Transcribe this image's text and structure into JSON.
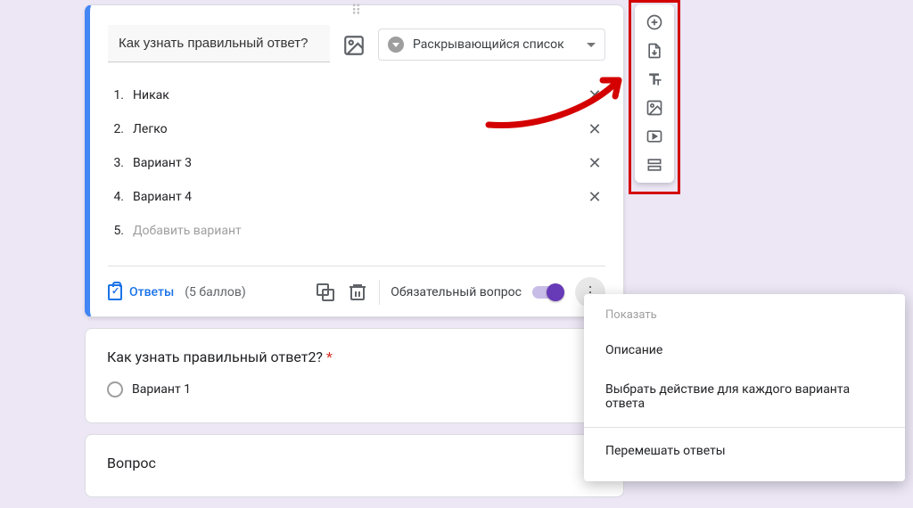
{
  "question1": {
    "title": "Как узнать правильный ответ?",
    "type_label": "Раскрывающийся список",
    "options": [
      {
        "n": "1.",
        "label": "Никак",
        "removable": true
      },
      {
        "n": "2.",
        "label": "Легко",
        "removable": true
      },
      {
        "n": "3.",
        "label": "Вариант 3",
        "removable": true
      },
      {
        "n": "4.",
        "label": "Вариант 4",
        "removable": true
      },
      {
        "n": "5.",
        "label": "Добавить вариант",
        "removable": false,
        "placeholder": true
      }
    ],
    "footer": {
      "answers_label": "Ответы",
      "score": "(5 баллов)",
      "required_label": "Обязательный вопрос",
      "required_on": true
    }
  },
  "question2": {
    "title": "Как узнать правильный ответ2?",
    "required_mark": "*",
    "options": [
      {
        "label": "Вариант 1"
      }
    ]
  },
  "question3": {
    "title": "Вопрос"
  },
  "side_toolbar": {
    "items": [
      "add-question",
      "import-questions",
      "add-title",
      "add-image",
      "add-video",
      "add-section"
    ]
  },
  "popup": {
    "header": "Показать",
    "items": [
      "Описание",
      "Выбрать действие для каждого варианта ответа"
    ],
    "after_sep": [
      "Перемешать ответы"
    ]
  }
}
